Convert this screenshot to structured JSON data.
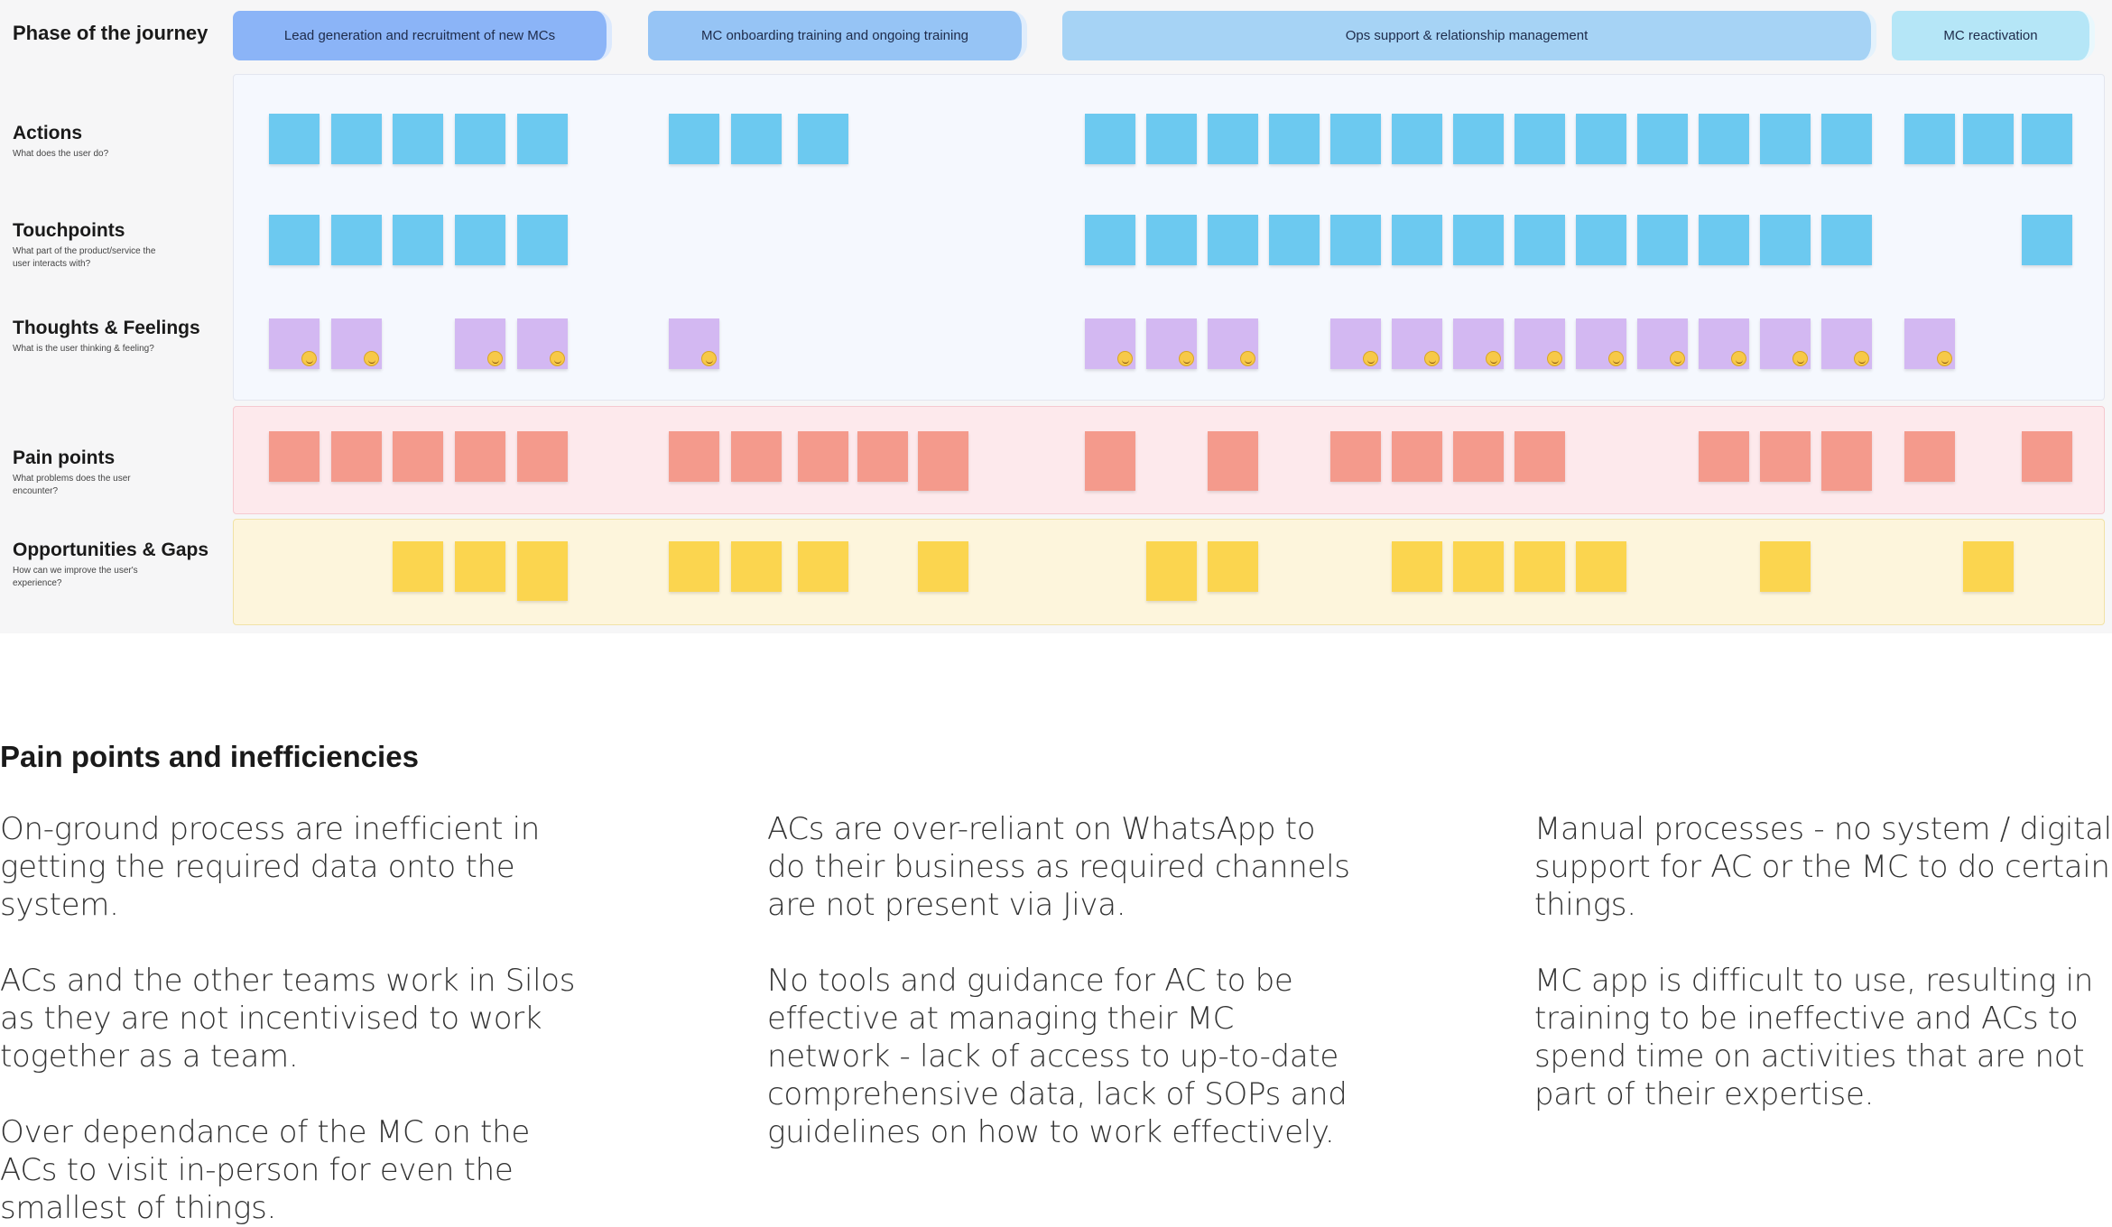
{
  "journey": {
    "phase_title": "Phase of the journey",
    "phases": [
      {
        "label": "Lead generation and recruitment of new MCs",
        "color": "#8bb4f7"
      },
      {
        "label": "MC onboarding training and ongoing training",
        "color": "#96c4f5"
      },
      {
        "label": "Ops support & relationship management",
        "color": "#a6d3f5"
      },
      {
        "label": "MC reactivation",
        "color": "#b5e6f7"
      }
    ],
    "rows": [
      {
        "title": "Actions",
        "subtitle": "What does the user do?"
      },
      {
        "title": "Touchpoints",
        "subtitle": "What part of the product/service the user interacts with?"
      },
      {
        "title": "Thoughts & Feelings",
        "subtitle": "What is the user thinking & feeling?"
      },
      {
        "title": "Pain points",
        "subtitle": "What problems does the user encounter?"
      },
      {
        "title": "Opportunities & Gaps",
        "subtitle": "How can we improve the user's experience?"
      }
    ],
    "note_colors": {
      "actions": "#6cc9f0",
      "touchpoints": "#6cc9f0",
      "thoughts": "#d3b8f2",
      "pain": "#f49a8c",
      "opportunities": "#fbd54f"
    }
  },
  "insights": {
    "title": "Pain points and inefficiencies",
    "columns": [
      [
        "On-ground process are inefficient in getting the required data onto the system.",
        "ACs and the other teams work in Silos as they are not incentivised to work together as a team.",
        "Over dependance of the MC on the ACs to visit in-person for even the smallest of things."
      ],
      [
        "ACs are over-reliant on WhatsApp to do their business as required channels are not present via Jiva.",
        "No tools and guidance for AC to be effective at managing their MC network - lack of access to up-to-date comprehensive data, lack of SOPs and guidelines on how to work effectively."
      ],
      [
        "Manual processes - no system / digital support for AC or the MC to do certain things.",
        "MC app is difficult to use, resulting in training to be ineffective and ACs to spend time on activities that are not part of their expertise."
      ]
    ]
  }
}
